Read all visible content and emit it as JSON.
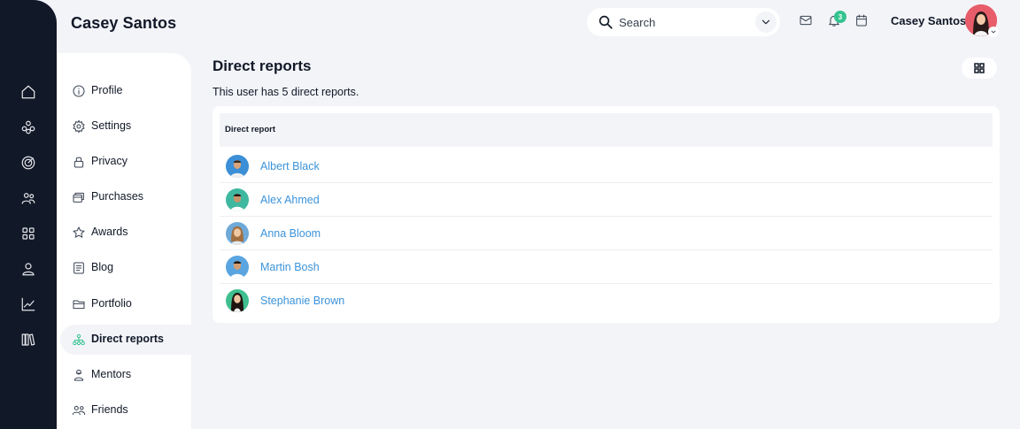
{
  "app": {
    "title": "Casey Santos"
  },
  "rail": {
    "items": [
      {
        "icon": "home-icon"
      },
      {
        "icon": "team-icon"
      },
      {
        "icon": "target-icon"
      },
      {
        "icon": "users-icon"
      },
      {
        "icon": "apps-icon"
      },
      {
        "icon": "user-icon"
      },
      {
        "icon": "chart-icon"
      },
      {
        "icon": "library-icon"
      }
    ]
  },
  "header": {
    "search": {
      "placeholder": "Search"
    },
    "notifications_count": "3",
    "user_name": "Casey Santos"
  },
  "subnav": {
    "items": [
      {
        "label": "Profile",
        "icon": "info-icon"
      },
      {
        "label": "Settings",
        "icon": "gear-icon"
      },
      {
        "label": "Privacy",
        "icon": "lock-icon"
      },
      {
        "label": "Purchases",
        "icon": "purchases-icon"
      },
      {
        "label": "Awards",
        "icon": "star-icon"
      },
      {
        "label": "Blog",
        "icon": "blog-icon"
      },
      {
        "label": "Portfolio",
        "icon": "folder-icon"
      },
      {
        "label": "Direct reports",
        "icon": "org-chart-icon",
        "active": true
      },
      {
        "label": "Mentors",
        "icon": "mentor-icon"
      },
      {
        "label": "Friends",
        "icon": "friends-icon"
      }
    ]
  },
  "main": {
    "title": "Direct reports",
    "description": "This user has 5 direct reports.",
    "table": {
      "column_header": "Direct report",
      "rows": [
        {
          "name": "Albert Black"
        },
        {
          "name": "Alex Ahmed"
        },
        {
          "name": "Anna Bloom"
        },
        {
          "name": "Martin Bosh"
        },
        {
          "name": "Stephanie Brown"
        }
      ]
    }
  },
  "colors": {
    "rail_bg": "#111827",
    "accent_green": "#34c38f",
    "link_blue": "#3b93d9",
    "page_bg": "#f3f4f8"
  }
}
